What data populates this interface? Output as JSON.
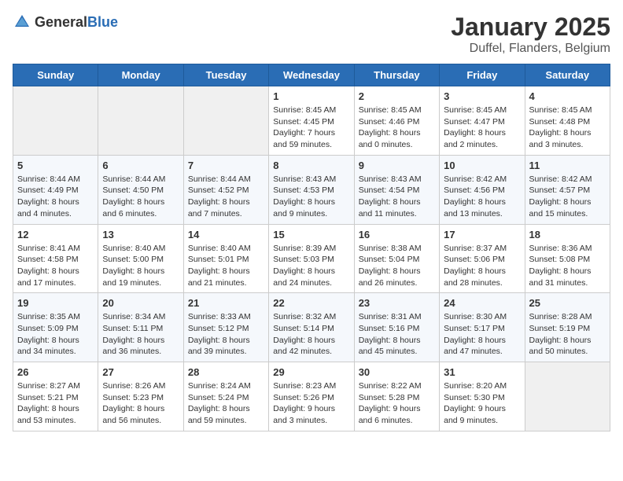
{
  "header": {
    "logo_general": "General",
    "logo_blue": "Blue",
    "month": "January 2025",
    "location": "Duffel, Flanders, Belgium"
  },
  "days_of_week": [
    "Sunday",
    "Monday",
    "Tuesday",
    "Wednesday",
    "Thursday",
    "Friday",
    "Saturday"
  ],
  "weeks": [
    [
      {
        "day": "",
        "info": ""
      },
      {
        "day": "",
        "info": ""
      },
      {
        "day": "",
        "info": ""
      },
      {
        "day": "1",
        "info": "Sunrise: 8:45 AM\nSunset: 4:45 PM\nDaylight: 7 hours\nand 59 minutes."
      },
      {
        "day": "2",
        "info": "Sunrise: 8:45 AM\nSunset: 4:46 PM\nDaylight: 8 hours\nand 0 minutes."
      },
      {
        "day": "3",
        "info": "Sunrise: 8:45 AM\nSunset: 4:47 PM\nDaylight: 8 hours\nand 2 minutes."
      },
      {
        "day": "4",
        "info": "Sunrise: 8:45 AM\nSunset: 4:48 PM\nDaylight: 8 hours\nand 3 minutes."
      }
    ],
    [
      {
        "day": "5",
        "info": "Sunrise: 8:44 AM\nSunset: 4:49 PM\nDaylight: 8 hours\nand 4 minutes."
      },
      {
        "day": "6",
        "info": "Sunrise: 8:44 AM\nSunset: 4:50 PM\nDaylight: 8 hours\nand 6 minutes."
      },
      {
        "day": "7",
        "info": "Sunrise: 8:44 AM\nSunset: 4:52 PM\nDaylight: 8 hours\nand 7 minutes."
      },
      {
        "day": "8",
        "info": "Sunrise: 8:43 AM\nSunset: 4:53 PM\nDaylight: 8 hours\nand 9 minutes."
      },
      {
        "day": "9",
        "info": "Sunrise: 8:43 AM\nSunset: 4:54 PM\nDaylight: 8 hours\nand 11 minutes."
      },
      {
        "day": "10",
        "info": "Sunrise: 8:42 AM\nSunset: 4:56 PM\nDaylight: 8 hours\nand 13 minutes."
      },
      {
        "day": "11",
        "info": "Sunrise: 8:42 AM\nSunset: 4:57 PM\nDaylight: 8 hours\nand 15 minutes."
      }
    ],
    [
      {
        "day": "12",
        "info": "Sunrise: 8:41 AM\nSunset: 4:58 PM\nDaylight: 8 hours\nand 17 minutes."
      },
      {
        "day": "13",
        "info": "Sunrise: 8:40 AM\nSunset: 5:00 PM\nDaylight: 8 hours\nand 19 minutes."
      },
      {
        "day": "14",
        "info": "Sunrise: 8:40 AM\nSunset: 5:01 PM\nDaylight: 8 hours\nand 21 minutes."
      },
      {
        "day": "15",
        "info": "Sunrise: 8:39 AM\nSunset: 5:03 PM\nDaylight: 8 hours\nand 24 minutes."
      },
      {
        "day": "16",
        "info": "Sunrise: 8:38 AM\nSunset: 5:04 PM\nDaylight: 8 hours\nand 26 minutes."
      },
      {
        "day": "17",
        "info": "Sunrise: 8:37 AM\nSunset: 5:06 PM\nDaylight: 8 hours\nand 28 minutes."
      },
      {
        "day": "18",
        "info": "Sunrise: 8:36 AM\nSunset: 5:08 PM\nDaylight: 8 hours\nand 31 minutes."
      }
    ],
    [
      {
        "day": "19",
        "info": "Sunrise: 8:35 AM\nSunset: 5:09 PM\nDaylight: 8 hours\nand 34 minutes."
      },
      {
        "day": "20",
        "info": "Sunrise: 8:34 AM\nSunset: 5:11 PM\nDaylight: 8 hours\nand 36 minutes."
      },
      {
        "day": "21",
        "info": "Sunrise: 8:33 AM\nSunset: 5:12 PM\nDaylight: 8 hours\nand 39 minutes."
      },
      {
        "day": "22",
        "info": "Sunrise: 8:32 AM\nSunset: 5:14 PM\nDaylight: 8 hours\nand 42 minutes."
      },
      {
        "day": "23",
        "info": "Sunrise: 8:31 AM\nSunset: 5:16 PM\nDaylight: 8 hours\nand 45 minutes."
      },
      {
        "day": "24",
        "info": "Sunrise: 8:30 AM\nSunset: 5:17 PM\nDaylight: 8 hours\nand 47 minutes."
      },
      {
        "day": "25",
        "info": "Sunrise: 8:28 AM\nSunset: 5:19 PM\nDaylight: 8 hours\nand 50 minutes."
      }
    ],
    [
      {
        "day": "26",
        "info": "Sunrise: 8:27 AM\nSunset: 5:21 PM\nDaylight: 8 hours\nand 53 minutes."
      },
      {
        "day": "27",
        "info": "Sunrise: 8:26 AM\nSunset: 5:23 PM\nDaylight: 8 hours\nand 56 minutes."
      },
      {
        "day": "28",
        "info": "Sunrise: 8:24 AM\nSunset: 5:24 PM\nDaylight: 8 hours\nand 59 minutes."
      },
      {
        "day": "29",
        "info": "Sunrise: 8:23 AM\nSunset: 5:26 PM\nDaylight: 9 hours\nand 3 minutes."
      },
      {
        "day": "30",
        "info": "Sunrise: 8:22 AM\nSunset: 5:28 PM\nDaylight: 9 hours\nand 6 minutes."
      },
      {
        "day": "31",
        "info": "Sunrise: 8:20 AM\nSunset: 5:30 PM\nDaylight: 9 hours\nand 9 minutes."
      },
      {
        "day": "",
        "info": ""
      }
    ]
  ]
}
